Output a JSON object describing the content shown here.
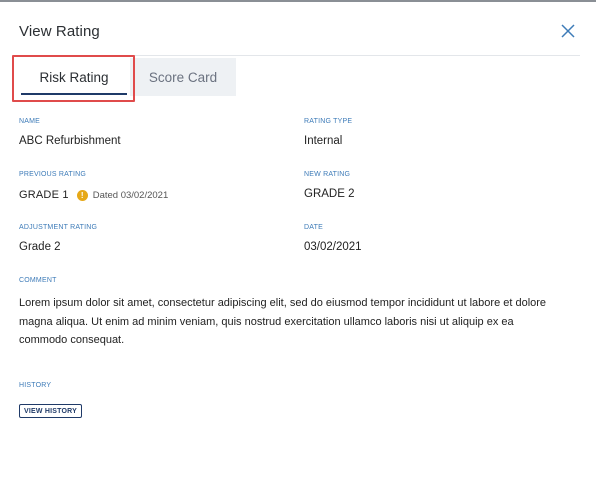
{
  "dialog": {
    "title": "View Rating",
    "close_icon": "close-icon"
  },
  "tabs": [
    {
      "label": "Risk Rating",
      "active": true
    },
    {
      "label": "Score Card",
      "active": false
    }
  ],
  "fields": {
    "name": {
      "label": "NAME",
      "value": "ABC Refurbishment"
    },
    "rating_type": {
      "label": "RATING TYPE",
      "value": "Internal"
    },
    "previous_rating": {
      "label": "PREVIOUS RATING",
      "value": "GRADE 1",
      "info_icon": "info-icon",
      "dated": "Dated 03/02/2021"
    },
    "new_rating": {
      "label": "NEW RATING",
      "value": "GRADE 2"
    },
    "adjustment_rating": {
      "label": "ADJUSTMENT RATING",
      "value": "Grade 2"
    },
    "date": {
      "label": "DATE",
      "value": "03/02/2021"
    },
    "comment": {
      "label": "COMMENT",
      "value": "Lorem ipsum dolor sit amet, consectetur adipiscing elit, sed do eiusmod tempor incididunt ut labore et dolore magna aliqua. Ut enim ad minim veniam, quis nostrud exercitation ullamco laboris nisi ut aliquip ex ea commodo consequat."
    }
  },
  "history": {
    "label": "HISTORY",
    "button_label": "VIEW HISTORY"
  },
  "colors": {
    "label_blue": "#3d7bb8",
    "navy": "#1f3a68",
    "highlight_red": "#e04b4b",
    "warning_amber": "#e6a817"
  }
}
